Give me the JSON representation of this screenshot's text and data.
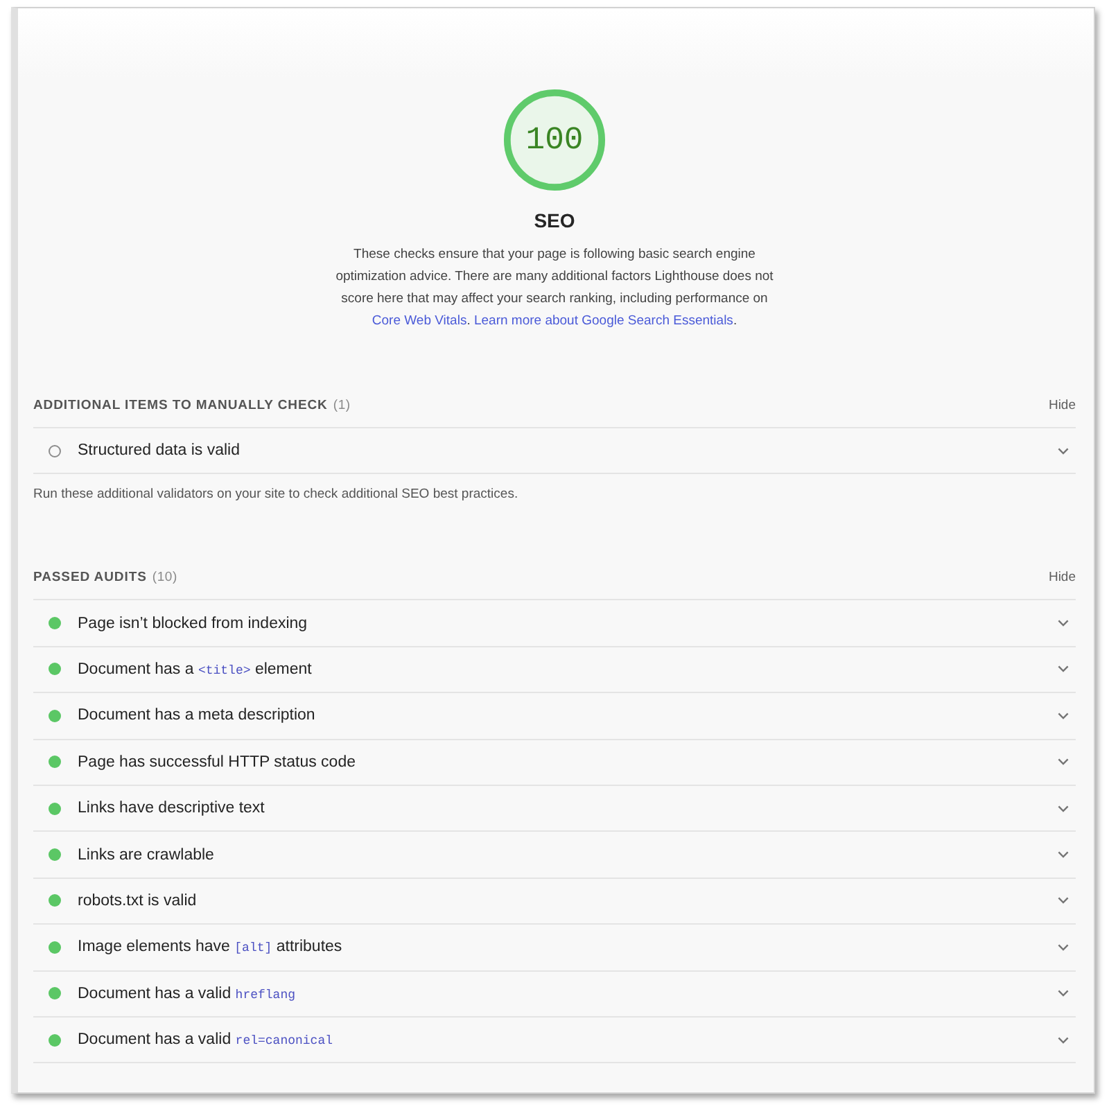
{
  "gauge": {
    "score": "100",
    "level": 1,
    "title": "SEO"
  },
  "description": [
    {
      "kind": "text",
      "text": "These checks ensure that your page is following basic search engine optimization advice. There are many additional factors Lighthouse does not score here that may affect your search ranking, including performance on "
    },
    {
      "kind": "link",
      "text": "Core Web Vitals"
    },
    {
      "kind": "text",
      "text": ". "
    },
    {
      "kind": "link",
      "text": "Learn more about Google Search Essentials"
    },
    {
      "kind": "text",
      "text": "."
    }
  ],
  "sections": [
    {
      "title": "ADDITIONAL ITEMS TO MANUALLY CHECK",
      "count": "(1)",
      "toggle": "Hide",
      "audits": [
        {
          "kind": "manual",
          "expanded": false,
          "title": [
            {
              "kind": "text",
              "text": "Structured data is valid"
            }
          ]
        }
      ],
      "note": "Run these additional validators on your site to check additional SEO best practices."
    },
    {
      "title": "PASSED AUDITS",
      "count": "(10)",
      "toggle": "Hide",
      "audits": [
        {
          "kind": "passed",
          "expanded": false,
          "title": [
            {
              "kind": "text",
              "text": "Page isn’t blocked from indexing"
            }
          ]
        },
        {
          "kind": "passed",
          "expanded": false,
          "title": [
            {
              "kind": "text",
              "text": "Document has a "
            },
            {
              "kind": "code",
              "text": "<title>"
            },
            {
              "kind": "text",
              "text": " element"
            }
          ]
        },
        {
          "kind": "passed",
          "expanded": false,
          "title": [
            {
              "kind": "text",
              "text": "Document has a meta description"
            }
          ]
        },
        {
          "kind": "passed",
          "expanded": false,
          "title": [
            {
              "kind": "text",
              "text": "Page has successful HTTP status code"
            }
          ]
        },
        {
          "kind": "passed",
          "expanded": false,
          "title": [
            {
              "kind": "text",
              "text": "Links have descriptive text"
            }
          ]
        },
        {
          "kind": "passed",
          "expanded": false,
          "title": [
            {
              "kind": "text",
              "text": "Links are crawlable"
            }
          ]
        },
        {
          "kind": "passed",
          "expanded": false,
          "title": [
            {
              "kind": "text",
              "text": "robots.txt is valid"
            }
          ]
        },
        {
          "kind": "passed",
          "expanded": false,
          "title": [
            {
              "kind": "text",
              "text": "Image elements have "
            },
            {
              "kind": "code",
              "text": "[alt]"
            },
            {
              "kind": "text",
              "text": " attributes"
            }
          ]
        },
        {
          "kind": "passed",
          "expanded": false,
          "title": [
            {
              "kind": "text",
              "text": "Document has a valid "
            },
            {
              "kind": "code",
              "text": "hreflang"
            }
          ]
        },
        {
          "kind": "passed",
          "expanded": false,
          "title": [
            {
              "kind": "text",
              "text": "Document has a valid "
            },
            {
              "kind": "code",
              "text": "rel=canonical"
            }
          ]
        }
      ]
    }
  ]
}
